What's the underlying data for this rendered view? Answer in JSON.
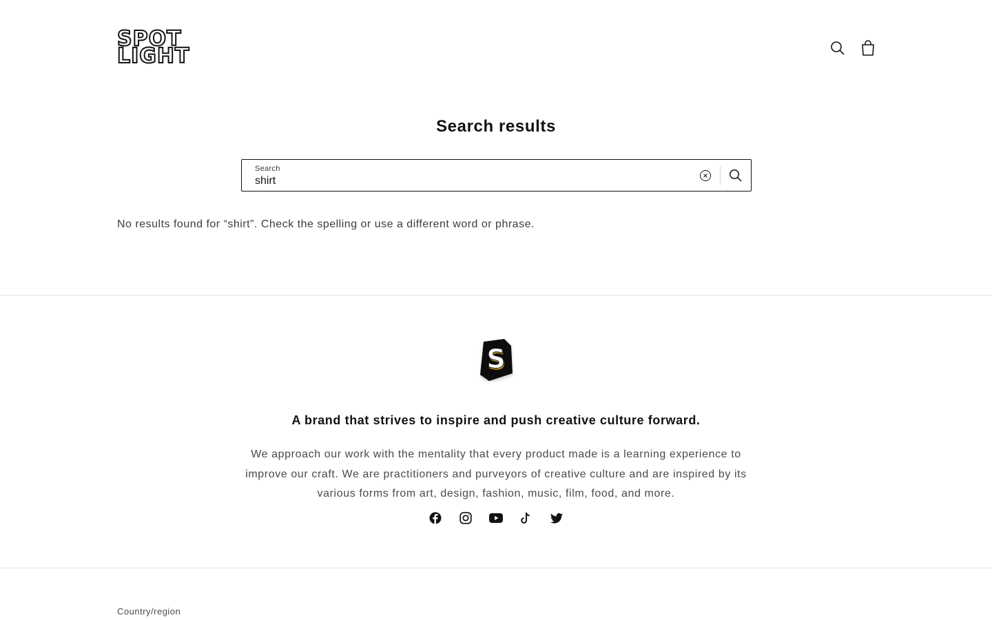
{
  "header": {
    "logo_line1": "SPOT",
    "logo_line2": "LIGHT",
    "search_icon": "search-icon",
    "cart_icon": "bag-icon"
  },
  "main": {
    "title": "Search results",
    "search": {
      "label": "Search",
      "value": "shirt",
      "placeholder": "Search",
      "clear_icon": "close-circle-icon",
      "submit_icon": "search-icon"
    },
    "no_results": "No results found for “shirt”. Check the spelling or use a different word or phrase."
  },
  "footer": {
    "brand_mark_letter": "S",
    "heading": "A brand that strives to inspire and push creative culture forward.",
    "text": "We approach our work with the mentality that every product made is a learning experience to improve our craft. We are practitioners and purveyors of creative culture and are inspired by its various forms from art, design, fashion, music, film, food, and more.",
    "socials": [
      "facebook-icon",
      "instagram-icon",
      "youtube-icon",
      "tiktok-icon",
      "twitter-icon"
    ],
    "country_label": "Country/region"
  },
  "colors": {
    "text": "#121212",
    "muted": "#4a4a4a",
    "divider": "#e5e5e5",
    "brand_gold": "#c9a227"
  }
}
